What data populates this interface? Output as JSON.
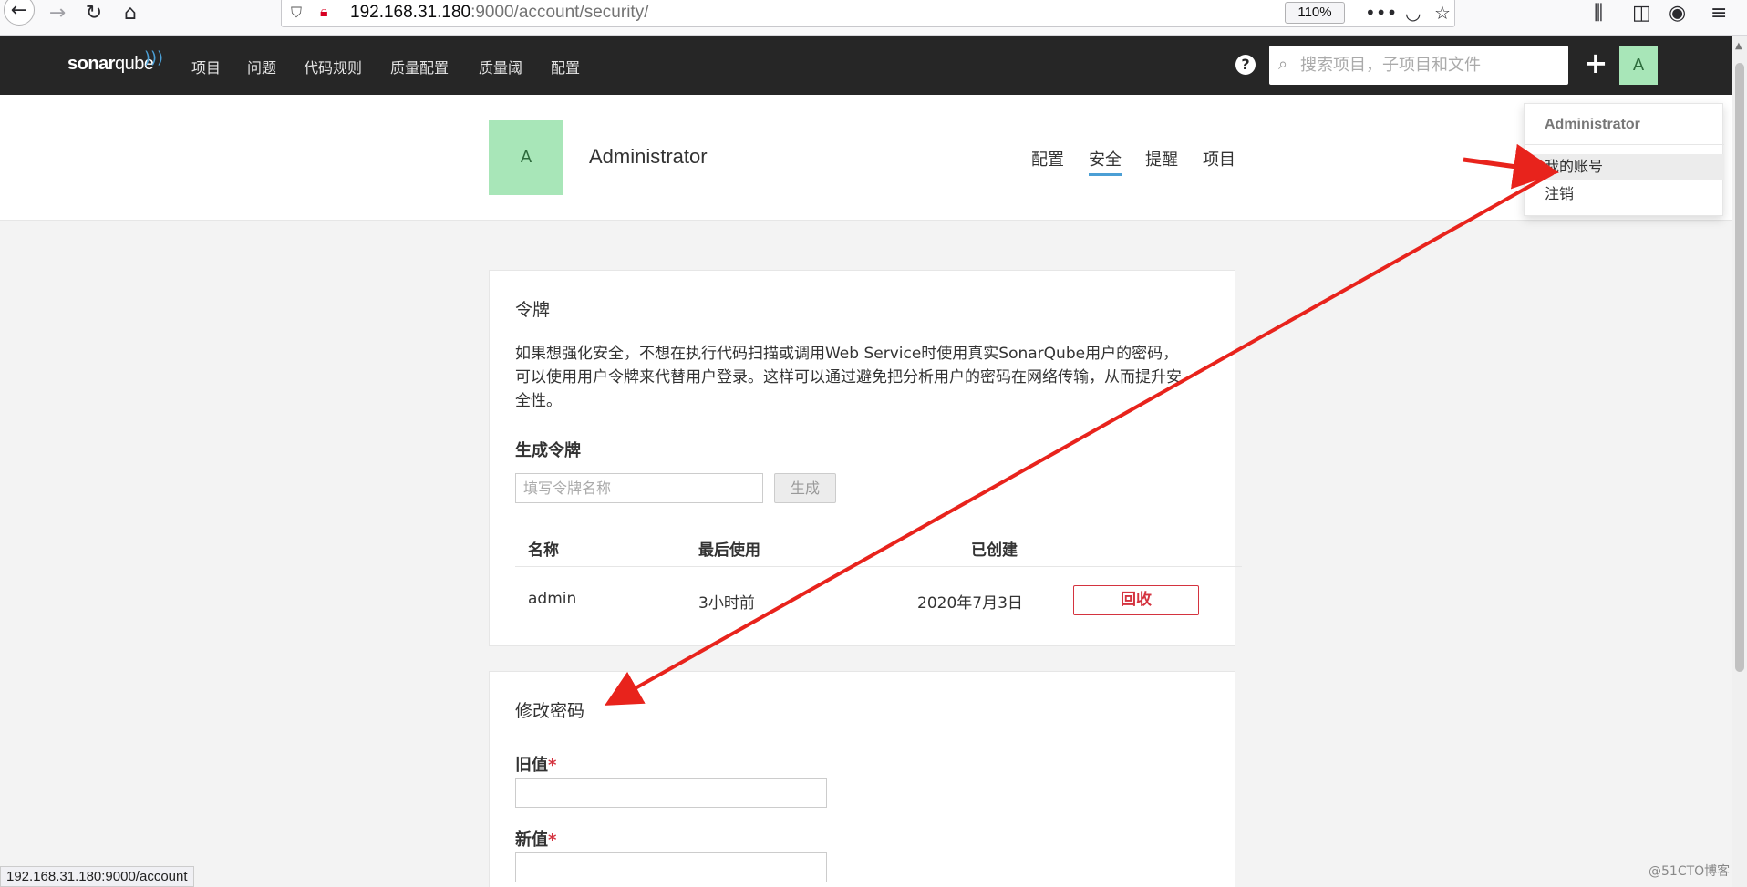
{
  "browser": {
    "url_host": "192.168.31.180",
    "url_rest": ":9000/account/security/",
    "zoom": "110%",
    "status_url": "192.168.31.180:9000/account"
  },
  "navbar": {
    "logo_bold": "sonar",
    "logo_light": "qube",
    "menu": [
      "项目",
      "问题",
      "代码规则",
      "质量配置",
      "质量阈",
      "配置"
    ],
    "search_placeholder": "搜索项目，子项目和文件",
    "avatar_letter": "A"
  },
  "account": {
    "avatar_letter": "A",
    "name": "Administrator",
    "tabs": [
      "配置",
      "安全",
      "提醒",
      "项目"
    ],
    "active_tab": "安全"
  },
  "dropdown": {
    "header": "Administrator",
    "items": [
      "我的账号",
      "注销"
    ]
  },
  "tokens": {
    "title": "令牌",
    "description": "如果想强化安全，不想在执行代码扫描或调用Web Service时使用真实SonarQube用户的密码，可以使用用户令牌来代替用户登录。这样可以通过避免把分析用户的密码在网络传输，从而提升安全性。",
    "generate_title": "生成令牌",
    "input_placeholder": "填写令牌名称",
    "generate_label": "生成",
    "columns": [
      "名称",
      "最后使用",
      "已创建"
    ],
    "rows": [
      {
        "name": "admin",
        "last_used": "3小时前",
        "created": "2020年7月3日",
        "action": "回收"
      }
    ]
  },
  "password": {
    "title": "修改密码",
    "old_label": "旧值",
    "new_label": "新值",
    "required_mark": "*"
  },
  "watermark": "@51CTO博客",
  "colors": {
    "navbar": "#262626",
    "accent": "#4b9fd5",
    "avatar": "#a8e6b8",
    "danger": "#d4333f",
    "annotation": "#e8231c"
  }
}
